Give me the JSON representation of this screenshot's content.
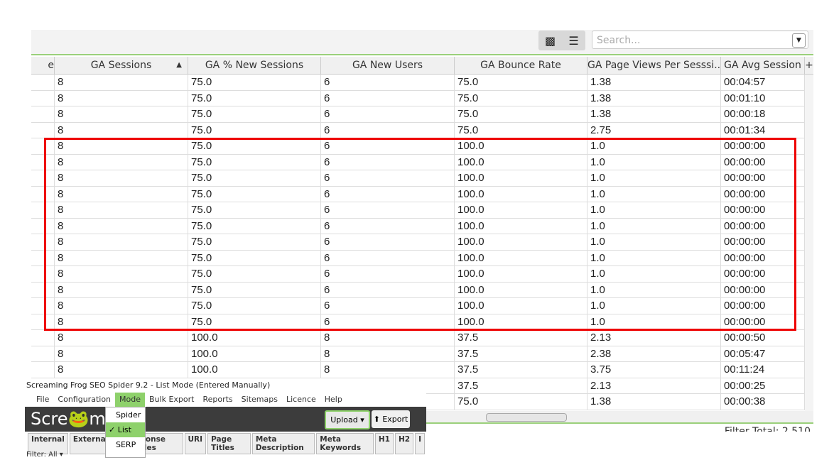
{
  "toolbar": {
    "search_placeholder": "Search...",
    "tree_icon": "sitemap-icon",
    "list_icon": "list-icon"
  },
  "columns": [
    "e",
    "GA Sessions",
    "GA % New Sessions",
    "GA New Users",
    "GA Bounce Rate",
    "GA Page Views Per Sesssi...",
    "GA Avg Session"
  ],
  "sort": {
    "column": "GA Sessions",
    "direction": "ascending"
  },
  "rows": [
    [
      "",
      "8",
      "75.0",
      "6",
      "75.0",
      "1.38",
      "00:04:57"
    ],
    [
      "",
      "8",
      "75.0",
      "6",
      "75.0",
      "1.38",
      "00:01:10"
    ],
    [
      "",
      "8",
      "75.0",
      "6",
      "75.0",
      "1.38",
      "00:00:18"
    ],
    [
      "",
      "8",
      "75.0",
      "6",
      "75.0",
      "2.75",
      "00:01:34"
    ],
    [
      "",
      "8",
      "75.0",
      "6",
      "100.0",
      "1.0",
      "00:00:00"
    ],
    [
      "",
      "8",
      "75.0",
      "6",
      "100.0",
      "1.0",
      "00:00:00"
    ],
    [
      "",
      "8",
      "75.0",
      "6",
      "100.0",
      "1.0",
      "00:00:00"
    ],
    [
      "",
      "8",
      "75.0",
      "6",
      "100.0",
      "1.0",
      "00:00:00"
    ],
    [
      "",
      "8",
      "75.0",
      "6",
      "100.0",
      "1.0",
      "00:00:00"
    ],
    [
      "",
      "8",
      "75.0",
      "6",
      "100.0",
      "1.0",
      "00:00:00"
    ],
    [
      "",
      "8",
      "75.0",
      "6",
      "100.0",
      "1.0",
      "00:00:00"
    ],
    [
      "",
      "8",
      "75.0",
      "6",
      "100.0",
      "1.0",
      "00:00:00"
    ],
    [
      "",
      "8",
      "75.0",
      "6",
      "100.0",
      "1.0",
      "00:00:00"
    ],
    [
      "",
      "8",
      "75.0",
      "6",
      "100.0",
      "1.0",
      "00:00:00"
    ],
    [
      "",
      "8",
      "75.0",
      "6",
      "100.0",
      "1.0",
      "00:00:00"
    ],
    [
      "",
      "8",
      "75.0",
      "6",
      "100.0",
      "1.0",
      "00:00:00"
    ],
    [
      "",
      "8",
      "100.0",
      "8",
      "37.5",
      "2.13",
      "00:00:50"
    ],
    [
      "",
      "8",
      "100.0",
      "8",
      "37.5",
      "2.38",
      "00:05:47"
    ],
    [
      "",
      "8",
      "100.0",
      "8",
      "37.5",
      "3.75",
      "00:11:24"
    ],
    [
      "",
      "",
      "",
      "",
      "37.5",
      "2.13",
      "00:00:25"
    ],
    [
      "",
      "",
      "",
      "",
      "75.0",
      "1.38",
      "00:00:38"
    ]
  ],
  "status": {
    "filter_total": "Filter Total:  2,510"
  },
  "overlay": {
    "title": "Screaming Frog SEO Spider 9.2 - List Mode (Entered Manually)",
    "menu": [
      "File",
      "Configuration",
      "Mode",
      "Bulk Export",
      "Reports",
      "Sitemaps",
      "Licence",
      "Help"
    ],
    "logo": "Scre🐸ming",
    "upload": "Upload ▾",
    "export": "⬆ Export",
    "mode_options": [
      "Spider",
      "✓ List",
      "SERP"
    ],
    "tabs": [
      "Internal",
      "External",
      "P",
      "esponse Codes",
      "URI",
      "Page Titles",
      "Meta Description",
      "Meta Keywords",
      "H1",
      "H2",
      "I"
    ],
    "filter": "Filter:  All  ▾"
  },
  "colors": {
    "accent": "#8ed16b",
    "highlight": "#e00000"
  }
}
